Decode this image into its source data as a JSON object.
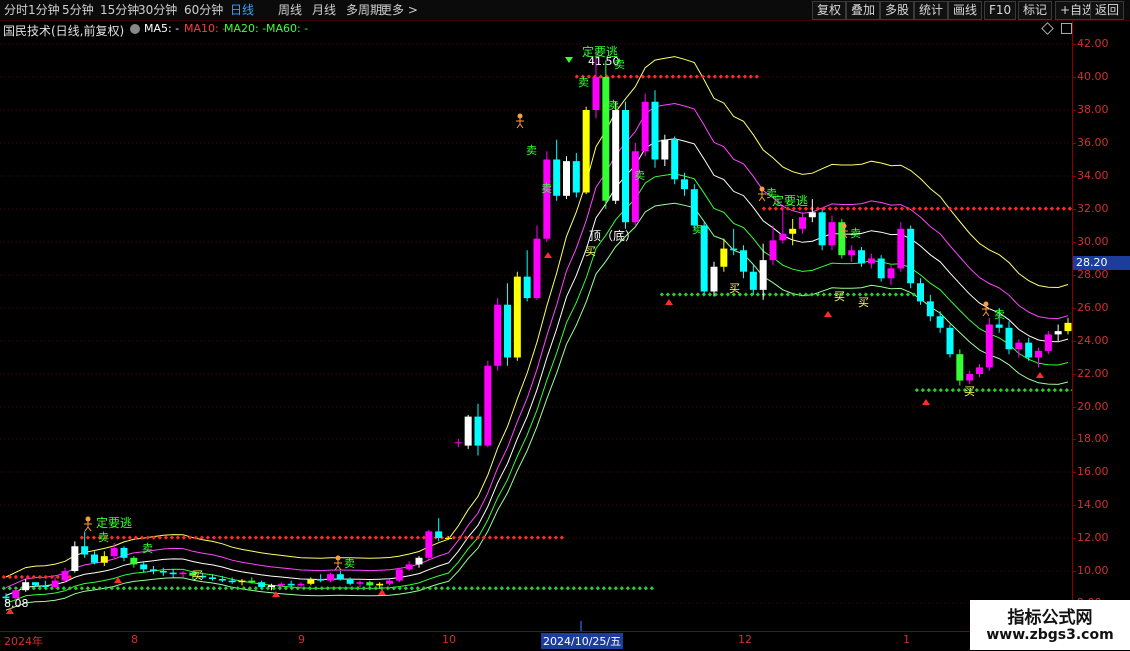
{
  "toolbar": {
    "periods": [
      "分时",
      "1分钟",
      "5分钟",
      "15分钟",
      "30分钟",
      "60分钟",
      "日线",
      "周线",
      "月线",
      "多周期",
      "更多 >"
    ],
    "active_period": "日线",
    "right_buttons": [
      "复权",
      "叠加",
      "多股",
      "统计",
      "画线",
      "F10",
      "标记",
      "+自选",
      "返回"
    ]
  },
  "info": {
    "title": "国民技术(日线,前复权)",
    "ma": [
      {
        "label": "MA5: -",
        "color": "#ffffff"
      },
      {
        "label": "MA10: -",
        "color": "#ff3c3c"
      },
      {
        "label": "MA20: -",
        "color": "#39ff39"
      },
      {
        "label": "MA60: -",
        "color": "#39ff39"
      }
    ]
  },
  "axis": {
    "ticks": [
      "42.00",
      "40.00",
      "38.00",
      "36.00",
      "34.00",
      "32.00",
      "30.00",
      "28.00",
      "26.00",
      "24.00",
      "22.00",
      "20.00",
      "18.00",
      "16.00",
      "14.00",
      "12.00",
      "10.00",
      "9.00"
    ],
    "current_price": "28.20"
  },
  "dates": {
    "labels": [
      "2024年",
      "8",
      "9",
      "10",
      "2024/10/25/五",
      "12",
      "1"
    ]
  },
  "annotations": {
    "escape_signal": "定要逃",
    "sell": "卖",
    "buy": "买",
    "top_bottom": "顶（底）",
    "high_price": "41.50",
    "low_price": "8.08"
  },
  "watermark": {
    "title": "指标公式网",
    "url": "www.zbgs3.com"
  },
  "colors": {
    "background": "#000000",
    "grid": "#5a0000",
    "up": "#ff00ff",
    "down": "#00ffff",
    "yellow_line": "#ffff66",
    "magenta_line": "#ff44ff",
    "green_line": "#33ff33",
    "white_line": "#ffffff"
  },
  "chart_data": {
    "type": "candlestick",
    "ylim": [
      8,
      43
    ],
    "candles": [
      [
        8.4,
        8.6,
        8.0,
        8.3
      ],
      [
        8.3,
        8.9,
        8.2,
        8.8
      ],
      [
        8.8,
        9.5,
        8.7,
        9.3
      ],
      [
        9.3,
        9.2,
        9.0,
        9.1
      ],
      [
        9.1,
        9.4,
        8.9,
        9.0
      ],
      [
        9.0,
        9.6,
        8.9,
        9.4
      ],
      [
        9.4,
        10.2,
        9.3,
        10.0
      ],
      [
        10.0,
        11.8,
        9.9,
        11.5
      ],
      [
        11.5,
        12.4,
        10.8,
        11.0
      ],
      [
        11.0,
        11.2,
        10.4,
        10.5
      ],
      [
        10.5,
        11.2,
        10.3,
        10.9
      ],
      [
        10.9,
        11.7,
        10.7,
        11.4
      ],
      [
        11.4,
        11.5,
        10.6,
        10.8
      ],
      [
        10.8,
        10.9,
        10.2,
        10.4
      ],
      [
        10.4,
        10.6,
        9.9,
        10.1
      ],
      [
        10.1,
        10.3,
        9.8,
        10.0
      ],
      [
        10.0,
        10.2,
        9.7,
        9.9
      ],
      [
        9.9,
        10.1,
        9.6,
        9.8
      ],
      [
        9.8,
        10.0,
        9.6,
        9.9
      ],
      [
        9.9,
        10.0,
        9.5,
        9.7
      ],
      [
        9.7,
        9.9,
        9.5,
        9.6
      ],
      [
        9.6,
        9.8,
        9.4,
        9.5
      ],
      [
        9.5,
        9.7,
        9.3,
        9.4
      ],
      [
        9.4,
        9.6,
        9.2,
        9.3
      ],
      [
        9.3,
        9.5,
        9.1,
        9.4
      ],
      [
        9.4,
        9.6,
        9.2,
        9.3
      ],
      [
        9.3,
        9.4,
        8.9,
        9.0
      ],
      [
        9.0,
        9.2,
        8.8,
        9.1
      ],
      [
        9.1,
        9.3,
        9.0,
        9.2
      ],
      [
        9.2,
        9.4,
        9.0,
        9.1
      ],
      [
        9.1,
        9.3,
        8.9,
        9.2
      ],
      [
        9.2,
        9.6,
        9.1,
        9.5
      ],
      [
        9.5,
        9.8,
        9.3,
        9.4
      ],
      [
        9.4,
        9.9,
        9.3,
        9.8
      ],
      [
        9.8,
        10.0,
        9.4,
        9.5
      ],
      [
        9.5,
        9.6,
        9.1,
        9.2
      ],
      [
        9.2,
        9.4,
        9.0,
        9.3
      ],
      [
        9.3,
        9.4,
        9.0,
        9.1
      ],
      [
        9.1,
        9.3,
        8.9,
        9.2
      ],
      [
        9.2,
        9.5,
        9.1,
        9.4
      ],
      [
        9.4,
        10.2,
        9.3,
        10.1
      ],
      [
        10.1,
        10.6,
        10.0,
        10.4
      ],
      [
        10.4,
        10.9,
        10.2,
        10.8
      ],
      [
        10.8,
        12.5,
        10.7,
        12.4
      ],
      [
        12.4,
        13.2,
        11.8,
        12.0
      ],
      [
        12.0,
        12.1,
        11.9,
        12.0
      ],
      [
        17.8,
        18.0,
        17.5,
        17.8
      ],
      [
        17.6,
        19.5,
        17.4,
        19.4
      ],
      [
        19.4,
        20.2,
        17.0,
        17.6
      ],
      [
        17.6,
        22.8,
        17.5,
        22.5
      ],
      [
        22.5,
        26.6,
        22.2,
        26.2
      ],
      [
        26.2,
        27.5,
        22.5,
        23.0
      ],
      [
        23.0,
        28.2,
        22.8,
        27.9
      ],
      [
        27.9,
        29.5,
        26.4,
        26.6
      ],
      [
        26.6,
        31.0,
        26.5,
        30.2
      ],
      [
        30.2,
        35.5,
        30.0,
        35.0
      ],
      [
        35.0,
        36.2,
        32.5,
        32.8
      ],
      [
        32.8,
        35.2,
        32.6,
        34.9
      ],
      [
        34.9,
        35.4,
        32.7,
        33.0
      ],
      [
        33.0,
        38.2,
        32.9,
        38.0
      ],
      [
        38.0,
        41.5,
        37.5,
        40.0
      ],
      [
        40.0,
        41.0,
        32.0,
        32.5
      ],
      [
        32.5,
        38.5,
        32.3,
        38.0
      ],
      [
        38.0,
        38.5,
        30.8,
        31.2
      ],
      [
        31.2,
        36.0,
        31.0,
        35.5
      ],
      [
        35.5,
        39.0,
        35.2,
        38.5
      ],
      [
        38.5,
        39.2,
        34.5,
        35.0
      ],
      [
        35.0,
        36.5,
        34.6,
        36.2
      ],
      [
        36.2,
        36.4,
        33.5,
        33.8
      ],
      [
        33.8,
        34.2,
        32.8,
        33.2
      ],
      [
        33.2,
        33.5,
        30.8,
        31.0
      ],
      [
        31.0,
        31.2,
        26.8,
        27.0
      ],
      [
        27.0,
        28.8,
        26.7,
        28.5
      ],
      [
        28.5,
        30.2,
        28.2,
        29.6
      ],
      [
        29.6,
        30.8,
        29.2,
        29.5
      ],
      [
        29.5,
        29.8,
        27.8,
        28.2
      ],
      [
        28.2,
        28.6,
        26.8,
        27.1
      ],
      [
        27.1,
        29.9,
        26.5,
        28.9
      ],
      [
        28.9,
        31.0,
        28.6,
        30.1
      ],
      [
        30.1,
        32.0,
        29.9,
        30.5
      ],
      [
        30.5,
        31.4,
        29.8,
        30.8
      ],
      [
        30.8,
        31.8,
        30.5,
        31.5
      ],
      [
        31.5,
        32.6,
        31.2,
        31.8
      ],
      [
        31.8,
        32.0,
        29.5,
        29.8
      ],
      [
        29.8,
        31.6,
        29.5,
        31.2
      ],
      [
        31.2,
        31.4,
        29.0,
        29.2
      ],
      [
        29.2,
        29.8,
        28.8,
        29.5
      ],
      [
        29.5,
        29.7,
        28.5,
        28.7
      ],
      [
        28.7,
        29.3,
        28.4,
        29.0
      ],
      [
        29.0,
        29.2,
        27.6,
        27.8
      ],
      [
        27.8,
        28.6,
        27.4,
        28.4
      ],
      [
        28.4,
        31.2,
        28.2,
        30.8
      ],
      [
        30.8,
        31.0,
        27.2,
        27.5
      ],
      [
        27.5,
        27.8,
        26.2,
        26.4
      ],
      [
        26.4,
        26.8,
        25.2,
        25.5
      ],
      [
        25.5,
        25.8,
        24.5,
        24.8
      ],
      [
        24.8,
        25.0,
        23.0,
        23.2
      ],
      [
        23.2,
        23.5,
        21.3,
        21.6
      ],
      [
        21.6,
        22.2,
        21.4,
        22.0
      ],
      [
        22.0,
        22.6,
        21.8,
        22.4
      ],
      [
        22.4,
        25.4,
        22.2,
        25.0
      ],
      [
        25.0,
        26.0,
        24.5,
        24.8
      ],
      [
        24.8,
        25.2,
        23.2,
        23.5
      ],
      [
        23.5,
        24.1,
        23.0,
        23.9
      ],
      [
        23.9,
        24.2,
        22.8,
        23.0
      ],
      [
        23.0,
        23.6,
        22.4,
        23.4
      ],
      [
        23.4,
        24.6,
        23.2,
        24.4
      ],
      [
        24.4,
        25.0,
        24.0,
        24.6
      ],
      [
        24.6,
        25.4,
        24.4,
        25.1
      ]
    ]
  }
}
